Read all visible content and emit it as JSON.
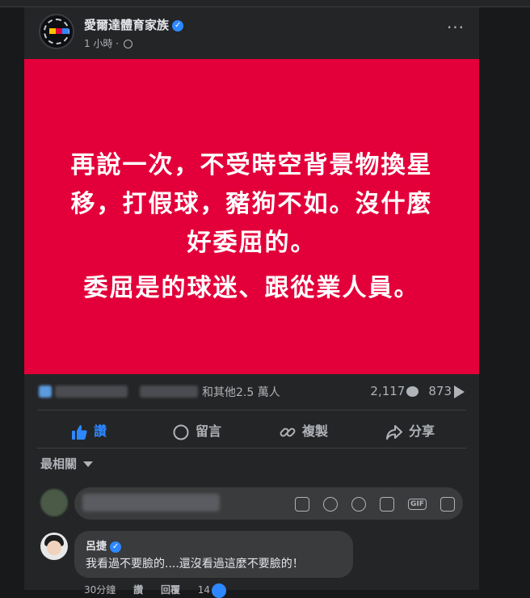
{
  "post": {
    "page_name": "愛爾達體育家族",
    "time": "1 小時",
    "separator": "·",
    "more": "···"
  },
  "image_text": {
    "lines": [
      "再說一次，不受時空背景物換星",
      "移，打假球，豬狗不如。沒什麼",
      "好委屈的。",
      "委屈是的球迷、跟從業人員。"
    ],
    "background": "#e3003a",
    "color": "#ffffff"
  },
  "reactions": {
    "others": "和其他2.5 萬人",
    "comments": "2,117",
    "shares": "873"
  },
  "actions": {
    "like": "讚",
    "comment": "留言",
    "copy": "複製",
    "share": "分享"
  },
  "comments_section": {
    "sort_label": "最相關"
  },
  "comment": {
    "author": "呂捷",
    "text": "我看過不要臉的....還沒看過這麼不要臉的！",
    "time": "30分鐘",
    "like_label": "讚",
    "reply_label": "回覆",
    "like_count": "14"
  },
  "colors": {
    "accent": "#2d88ff",
    "card_bg": "#242526",
    "page_bg": "#18191a"
  }
}
